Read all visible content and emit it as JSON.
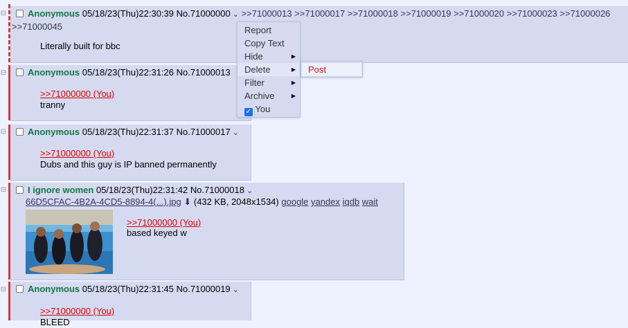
{
  "posts": [
    {
      "name": "Anonymous",
      "datetime": "05/18/23(Thu)22:30:39",
      "number": "No.71000000",
      "backlinks": ">>71000013 >>71000017 >>71000018 >>71000019 >>71000020 >>71000023 >>71000026",
      "backlinks_wrap": ">>71000045",
      "text": "Literally built for bbc"
    },
    {
      "name": "Anonymous",
      "datetime": "05/18/23(Thu)22:31:26",
      "number": "No.71000013",
      "quote": ">>71000000 (You)",
      "text": "tranny"
    },
    {
      "name": "Anonymous",
      "datetime": "05/18/23(Thu)22:31:37",
      "number": "No.71000017",
      "quote": ">>71000000 (You)",
      "text": "Dubs and this guy is IP banned permanently"
    },
    {
      "name": "I ignore women",
      "datetime": "05/18/23(Thu)22:31:42",
      "number": "No.71000018",
      "file": {
        "name": "66D5CFAC-4B2A-4CD5-8894-4(...).jpg",
        "info": "(432 KB, 2048x1534)",
        "links": [
          "google",
          "yandex",
          "iqdb",
          "wait"
        ]
      },
      "quote": ">>71000000 (You)",
      "text": "based keyed w"
    },
    {
      "name": "Anonymous",
      "datetime": "05/18/23(Thu)22:31:45",
      "number": "No.71000019",
      "quote": ">>71000000 (You)",
      "text": "BLEED"
    }
  ],
  "menu": {
    "items": [
      "Report",
      "Copy Text",
      "Hide",
      "Delete",
      "Filter",
      "Archive",
      "You"
    ],
    "submenu": [
      "Post"
    ]
  },
  "side_icon": "collapse-minus-icon",
  "colors": {
    "name": "#117743",
    "quote": "#dd0000",
    "bar": "#d33b3b",
    "post_bg": "#d6daf0"
  }
}
